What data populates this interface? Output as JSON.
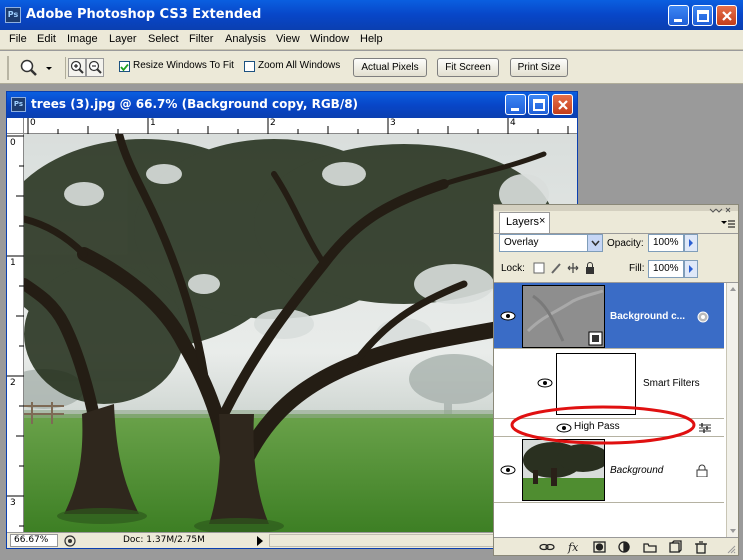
{
  "app": {
    "title": "Adobe Photoshop CS3 Extended",
    "logo_text": "Ps"
  },
  "menu": [
    "File",
    "Edit",
    "Image",
    "Layer",
    "Select",
    "Filter",
    "Analysis",
    "View",
    "Window",
    "Help"
  ],
  "options_bar": {
    "resize_windows_label": "Resize Windows To Fit",
    "resize_windows_checked": true,
    "zoom_all_label": "Zoom All Windows",
    "zoom_all_checked": false,
    "actual_pixels_label": "Actual Pixels",
    "fit_screen_label": "Fit Screen",
    "print_size_label": "Print Size"
  },
  "document": {
    "title": "trees (3).jpg @ 66.7% (Background copy, RGB/8)",
    "h_ruler_labels": [
      "0",
      "1",
      "2",
      "3",
      "4"
    ],
    "v_ruler_labels": [
      "0",
      "1",
      "2",
      "3"
    ],
    "zoom": "66.67%",
    "doc_info": "Doc: 1.37M/2.75M"
  },
  "layers_panel": {
    "tab_label": "Layers",
    "blend_mode": "Overlay",
    "opacity_label": "Opacity:",
    "opacity_value": "100%",
    "lock_label": "Lock:",
    "fill_label": "Fill:",
    "fill_value": "100%",
    "layers": [
      {
        "name": "Background c...",
        "selected": true
      },
      {
        "name": "Smart Filters"
      },
      {
        "name": "High Pass"
      },
      {
        "name": "Background",
        "locked": true
      }
    ]
  },
  "colors": {
    "title_blue": "#0846c8",
    "selected_layer": "#3a6cc6",
    "annotation_red": "#e01010",
    "grass": "#4a8a2c"
  }
}
